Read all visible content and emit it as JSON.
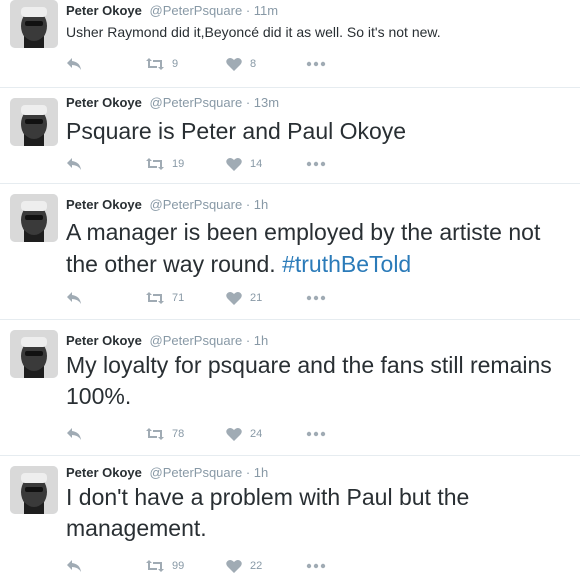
{
  "tweets": [
    {
      "name": "Peter Okoye",
      "handle": "@PeterPsquare",
      "separator": "·",
      "time": "11m",
      "text": "Usher Raymond did it,Beyoncé did it as well. So it's not new.",
      "hashtag": "",
      "retweets": "9",
      "likes": "8"
    },
    {
      "name": "Peter Okoye",
      "handle": "@PeterPsquare",
      "separator": "·",
      "time": "13m",
      "text": "Psquare is Peter and Paul Okoye",
      "hashtag": "",
      "retweets": "19",
      "likes": "14"
    },
    {
      "name": "Peter Okoye",
      "handle": "@PeterPsquare",
      "separator": "·",
      "time": "1h",
      "text": "A manager is been employed by the artiste not the other way round. ",
      "hashtag": "#truthBeTold",
      "retweets": "71",
      "likes": "21"
    },
    {
      "name": "Peter Okoye",
      "handle": "@PeterPsquare",
      "separator": "·",
      "time": "1h",
      "text": "My loyalty for psquare and the fans still remains 100%.",
      "hashtag": "",
      "retweets": "78",
      "likes": "24"
    },
    {
      "name": "Peter Okoye",
      "handle": "@PeterPsquare",
      "separator": "·",
      "time": "1h",
      "text": "I don't have a problem with Paul but the management.",
      "hashtag": "",
      "retweets": "99",
      "likes": "22"
    }
  ],
  "icons": {
    "reply": "reply-icon",
    "retweet": "retweet-icon",
    "like": "heart-icon",
    "more": "more-icon"
  },
  "colors": {
    "name": "#292f33",
    "muted": "#8899a6",
    "icon": "#a0abb4",
    "hashtag": "#2b7bb9",
    "divider": "#e6ecf0"
  }
}
